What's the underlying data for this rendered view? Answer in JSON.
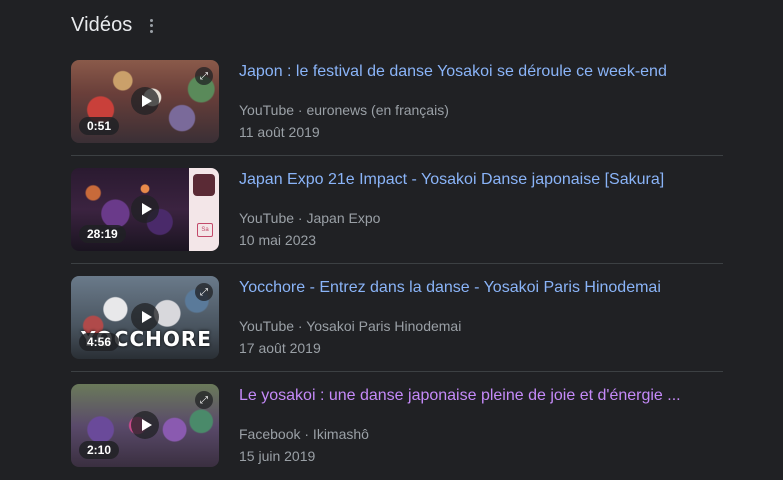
{
  "section": {
    "title": "Vidéos"
  },
  "videos": [
    {
      "title": "Japon : le festival de danse Yosakoi se déroule ce week-end",
      "source": "YouTube · euronews (en français)",
      "date": "11 août 2019",
      "duration": "0:51",
      "visited": false
    },
    {
      "title": "Japan Expo 21e Impact - Yosakoi Danse japonaise [Sakura]",
      "source": "YouTube · Japan Expo",
      "date": "10 mai 2023",
      "duration": "28:19",
      "visited": false
    },
    {
      "title": "Yocchore - Entrez dans la danse - Yosakoi Paris Hinodemai",
      "source": "YouTube · Yosakoi Paris Hinodemai",
      "date": "17 août 2019",
      "duration": "4:56",
      "overlay": "YOCCHORE",
      "visited": false
    },
    {
      "title": "Le yosakoi : une danse japonaise pleine de joie et d'énergie ...",
      "source": "Facebook · Ikimashô",
      "date": "15 juin 2019",
      "duration": "2:10",
      "visited": true
    }
  ],
  "thumbnail_badge": "Sa",
  "colors": {
    "background": "#202124",
    "link": "#8ab4f8",
    "visited_link": "#c58af9",
    "meta_text": "#9aa0a6",
    "divider": "#3c4043"
  },
  "icons": {
    "more": "more-vert-icon",
    "play": "play-icon",
    "expand": "expand-icon"
  }
}
